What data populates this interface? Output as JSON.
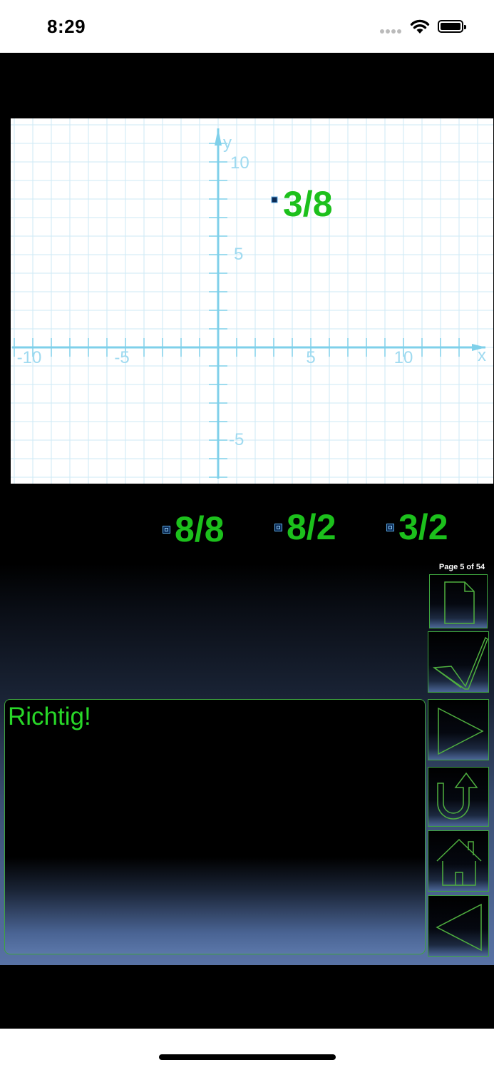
{
  "status": {
    "time": "8:29"
  },
  "graph": {
    "x_label": "x",
    "y_label": "y",
    "x_ticks": [
      "-10",
      "-5",
      "5",
      "10"
    ],
    "y_ticks": [
      "10",
      "5",
      "-5"
    ],
    "question_label": "3/8",
    "colors": {
      "grid": "#cdeaf5",
      "axis": "#7fd0ea",
      "label": "#9fdaf0"
    }
  },
  "answers": [
    {
      "label": "8/8"
    },
    {
      "label": "8/2"
    },
    {
      "label": "3/2"
    }
  ],
  "navigation": {
    "page_counter": "Page 5 of 54",
    "buttons": [
      "new-page",
      "check",
      "next",
      "undo",
      "home",
      "back"
    ]
  },
  "feedback": {
    "text": "Richtig!"
  },
  "colors": {
    "answer_green": "#1cc01c",
    "feedback_green": "#28d828",
    "button_border": "#3ea43e",
    "icon_green": "#4fb03f"
  }
}
